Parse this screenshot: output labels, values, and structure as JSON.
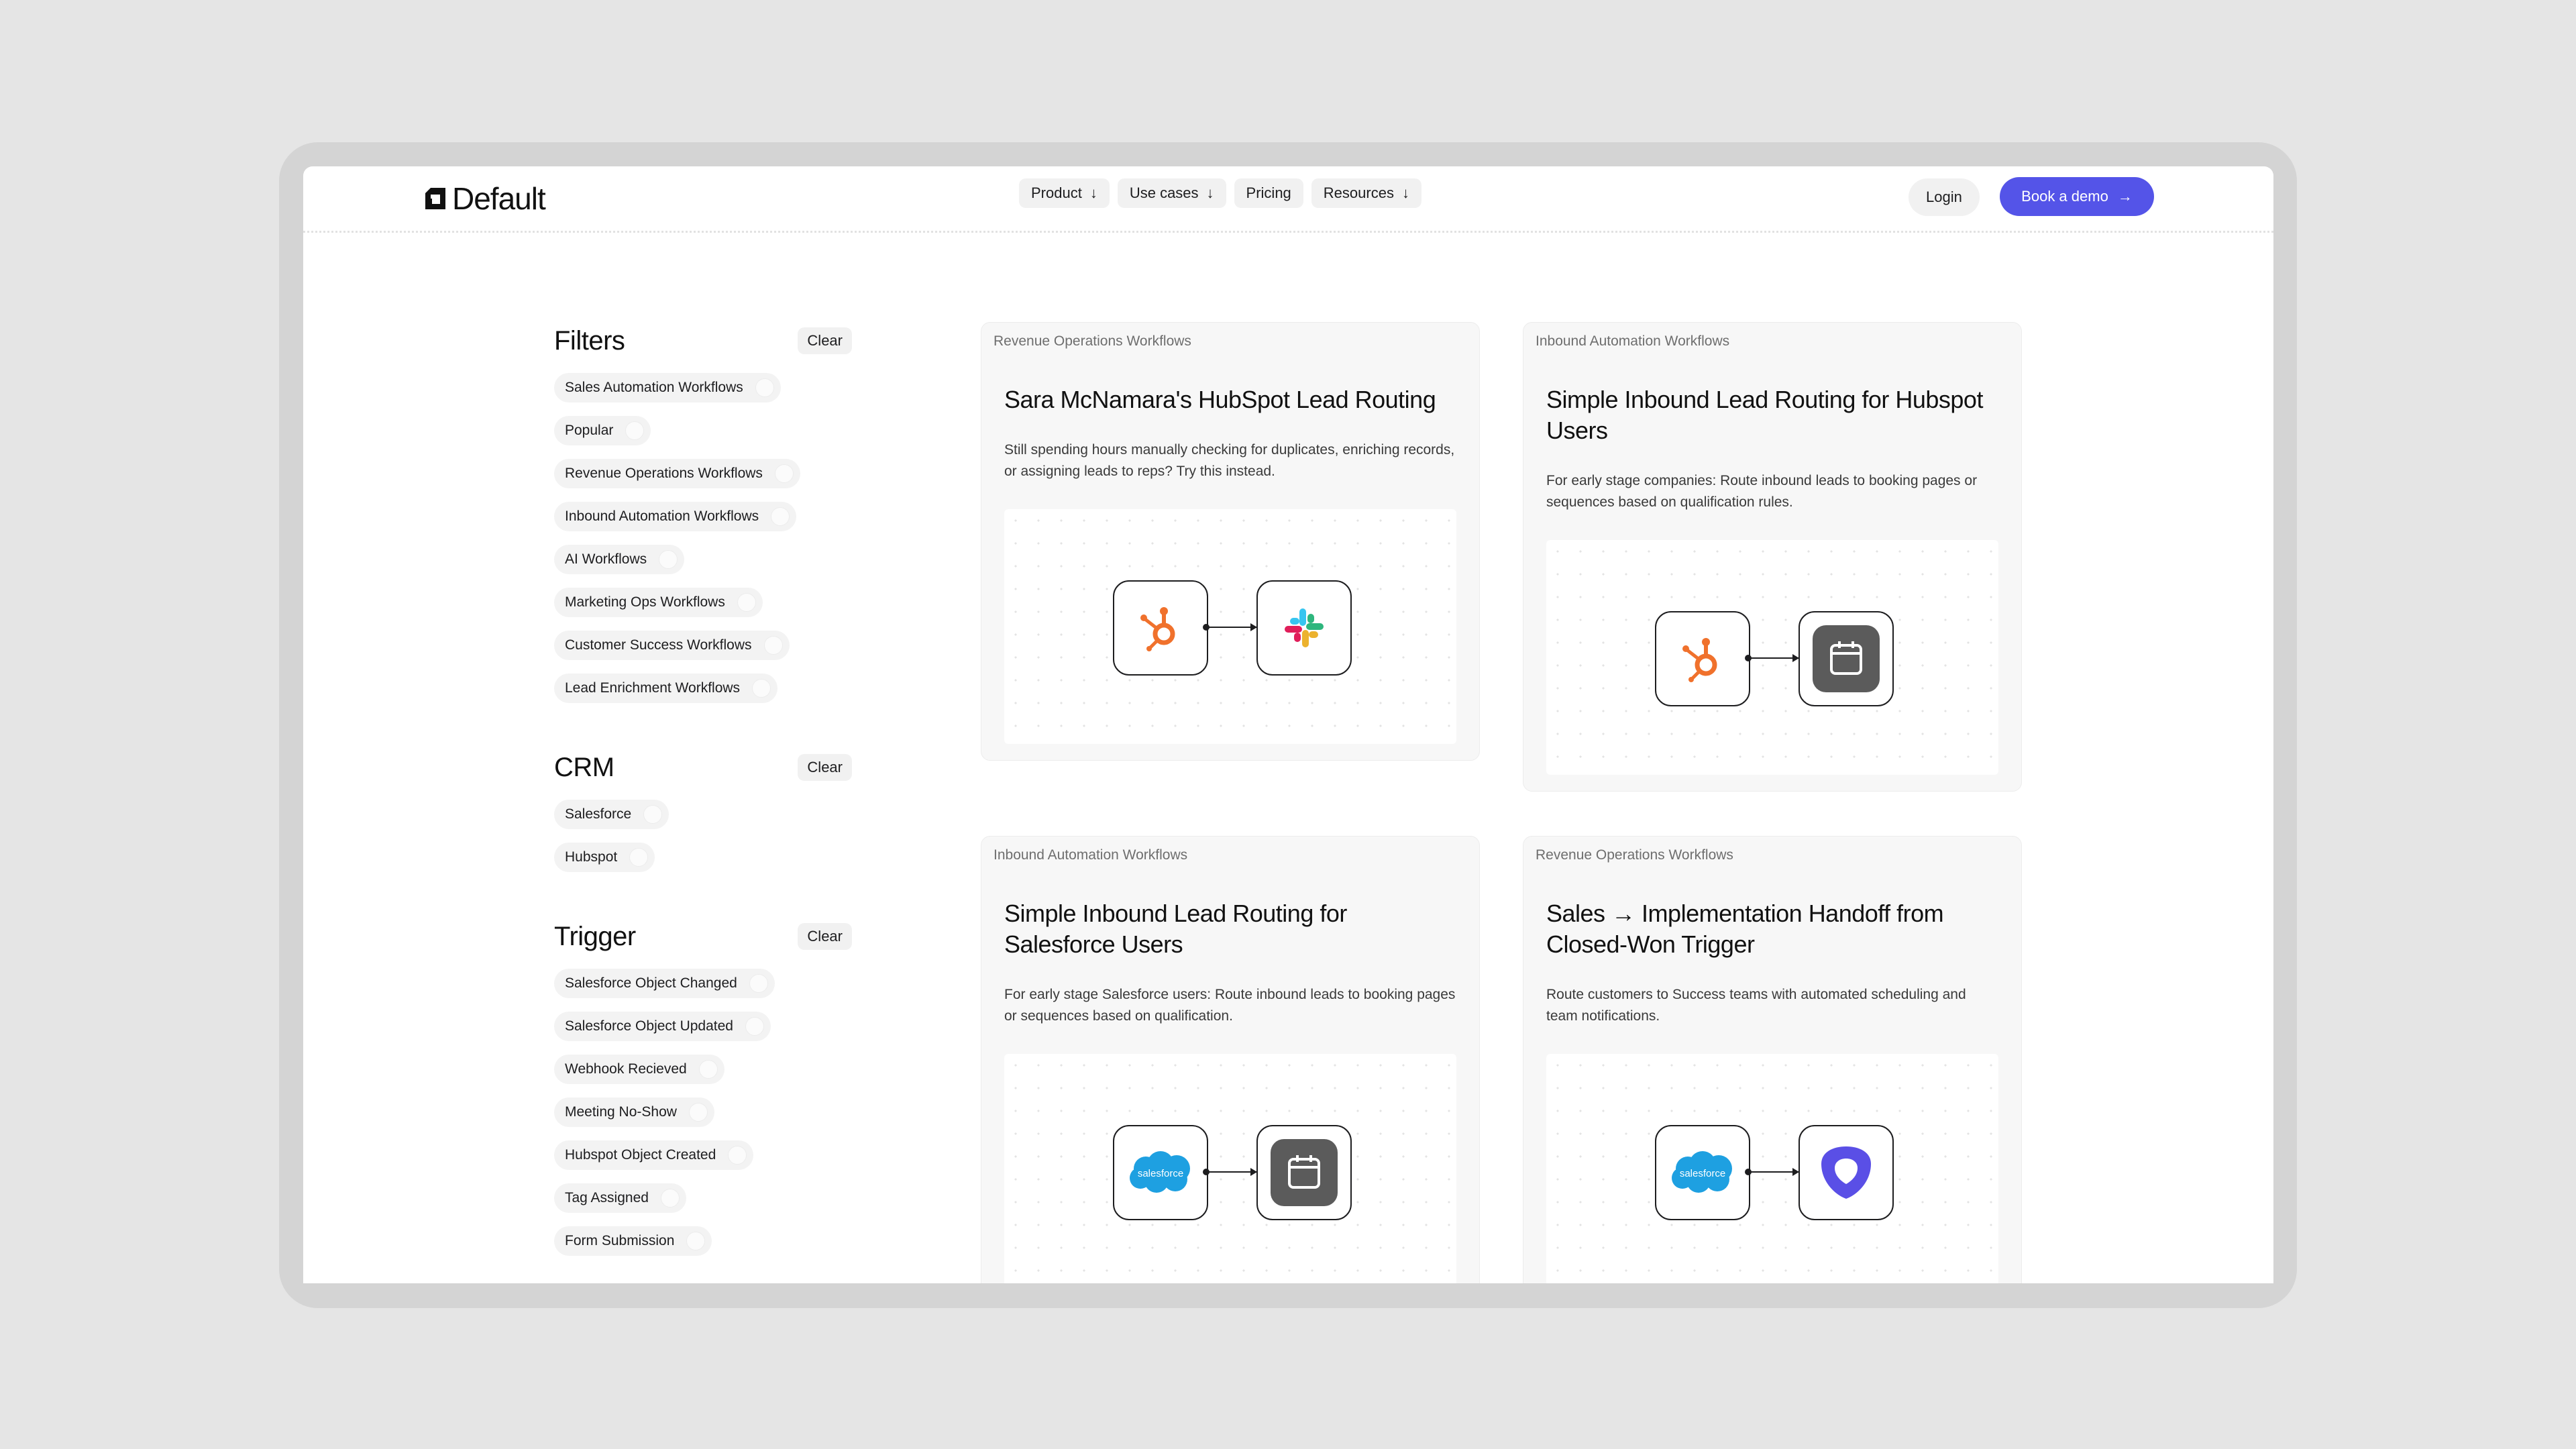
{
  "brand": {
    "name": "Default"
  },
  "nav": {
    "items": [
      {
        "label": "Product",
        "has_dropdown": true
      },
      {
        "label": "Use cases",
        "has_dropdown": true
      },
      {
        "label": "Pricing",
        "has_dropdown": false
      },
      {
        "label": "Resources",
        "has_dropdown": true
      }
    ],
    "login": "Login",
    "demo": "Book a demo"
  },
  "sidebar": {
    "filters": {
      "title": "Filters",
      "clear": "Clear",
      "items": [
        "Sales Automation Workflows",
        "Popular",
        "Revenue Operations Workflows",
        "Inbound Automation Workflows",
        "AI Workflows",
        "Marketing Ops Workflows",
        "Customer Success Workflows",
        "Lead Enrichment Workflows"
      ]
    },
    "crm": {
      "title": "CRM",
      "clear": "Clear",
      "items": [
        "Salesforce",
        "Hubspot"
      ]
    },
    "trigger": {
      "title": "Trigger",
      "clear": "Clear",
      "items": [
        "Salesforce Object Changed",
        "Salesforce Object Updated",
        "Webhook Recieved",
        "Meeting No-Show",
        "Hubspot Object Created",
        "Tag Assigned",
        "Form Submission"
      ]
    }
  },
  "cards": [
    {
      "tag": "Revenue Operations Workflows",
      "title": "Sara McNamara's HubSpot Lead Routing",
      "description": "Still spending hours manually checking for duplicates, enriching records, or assigning leads to reps? Try this instead.",
      "from_icon": "hubspot-icon",
      "to_icon": "slack-icon"
    },
    {
      "tag": "Inbound Automation Workflows",
      "title": "Simple Inbound Lead Routing for Hubspot Users",
      "description": "For early stage companies: Route inbound leads to booking pages or sequences based on qualification rules.",
      "from_icon": "hubspot-icon",
      "to_icon": "calendar-icon"
    },
    {
      "tag": "Inbound Automation Workflows",
      "title": "Simple Inbound Lead Routing for Salesforce Users",
      "description": "For early stage Salesforce users: Route inbound leads to booking pages or sequences based on qualification.",
      "from_icon": "salesforce-icon",
      "to_icon": "calendar-icon"
    },
    {
      "tag": "Revenue Operations Workflows",
      "title": "Sales → Implementation Handoff from Closed-Won Trigger",
      "description": "Route customers to Success teams with automated scheduling and team notifications.",
      "from_icon": "salesforce-icon",
      "to_icon": "shield-icon"
    }
  ],
  "icon_text": {
    "salesforce": "salesforce"
  },
  "colors": {
    "accent": "#5454e8",
    "hubspot": "#f0712c",
    "salesforce": "#1ea0e1",
    "shield": "#5a4fe6",
    "calendar_bg": "#5b5b5b"
  }
}
